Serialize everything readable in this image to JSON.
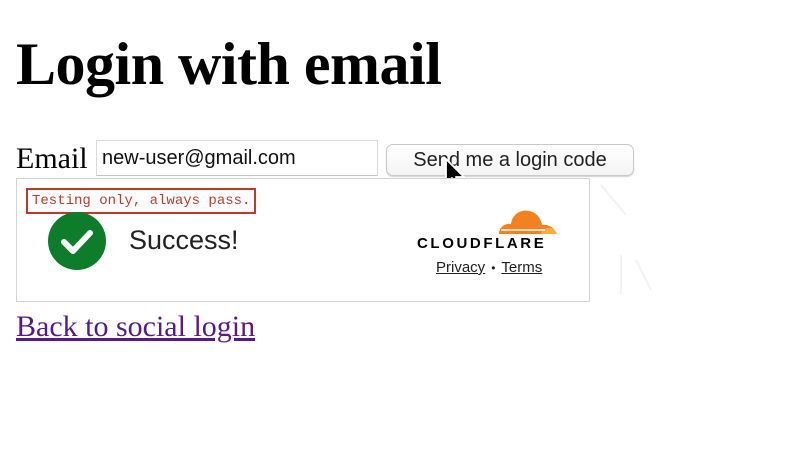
{
  "page": {
    "title": "Login with email",
    "back_link": "Back to social login"
  },
  "form": {
    "email_label": "Email",
    "email_value": "new-user@gmail.com",
    "send_button": "Send me a login code"
  },
  "captcha": {
    "test_notice": "Testing only, always pass.",
    "status": "Success!",
    "brand": "CLOUDFLARE",
    "privacy_link": "Privacy",
    "separator": "•",
    "terms_link": "Terms",
    "colors": {
      "success_green": "#0d7d2b",
      "brand_orange": "#f48120",
      "brand_orange_light": "#faad3f",
      "notice_red": "#c0392b"
    }
  },
  "colors": {
    "visited_link": "#551a8b"
  }
}
